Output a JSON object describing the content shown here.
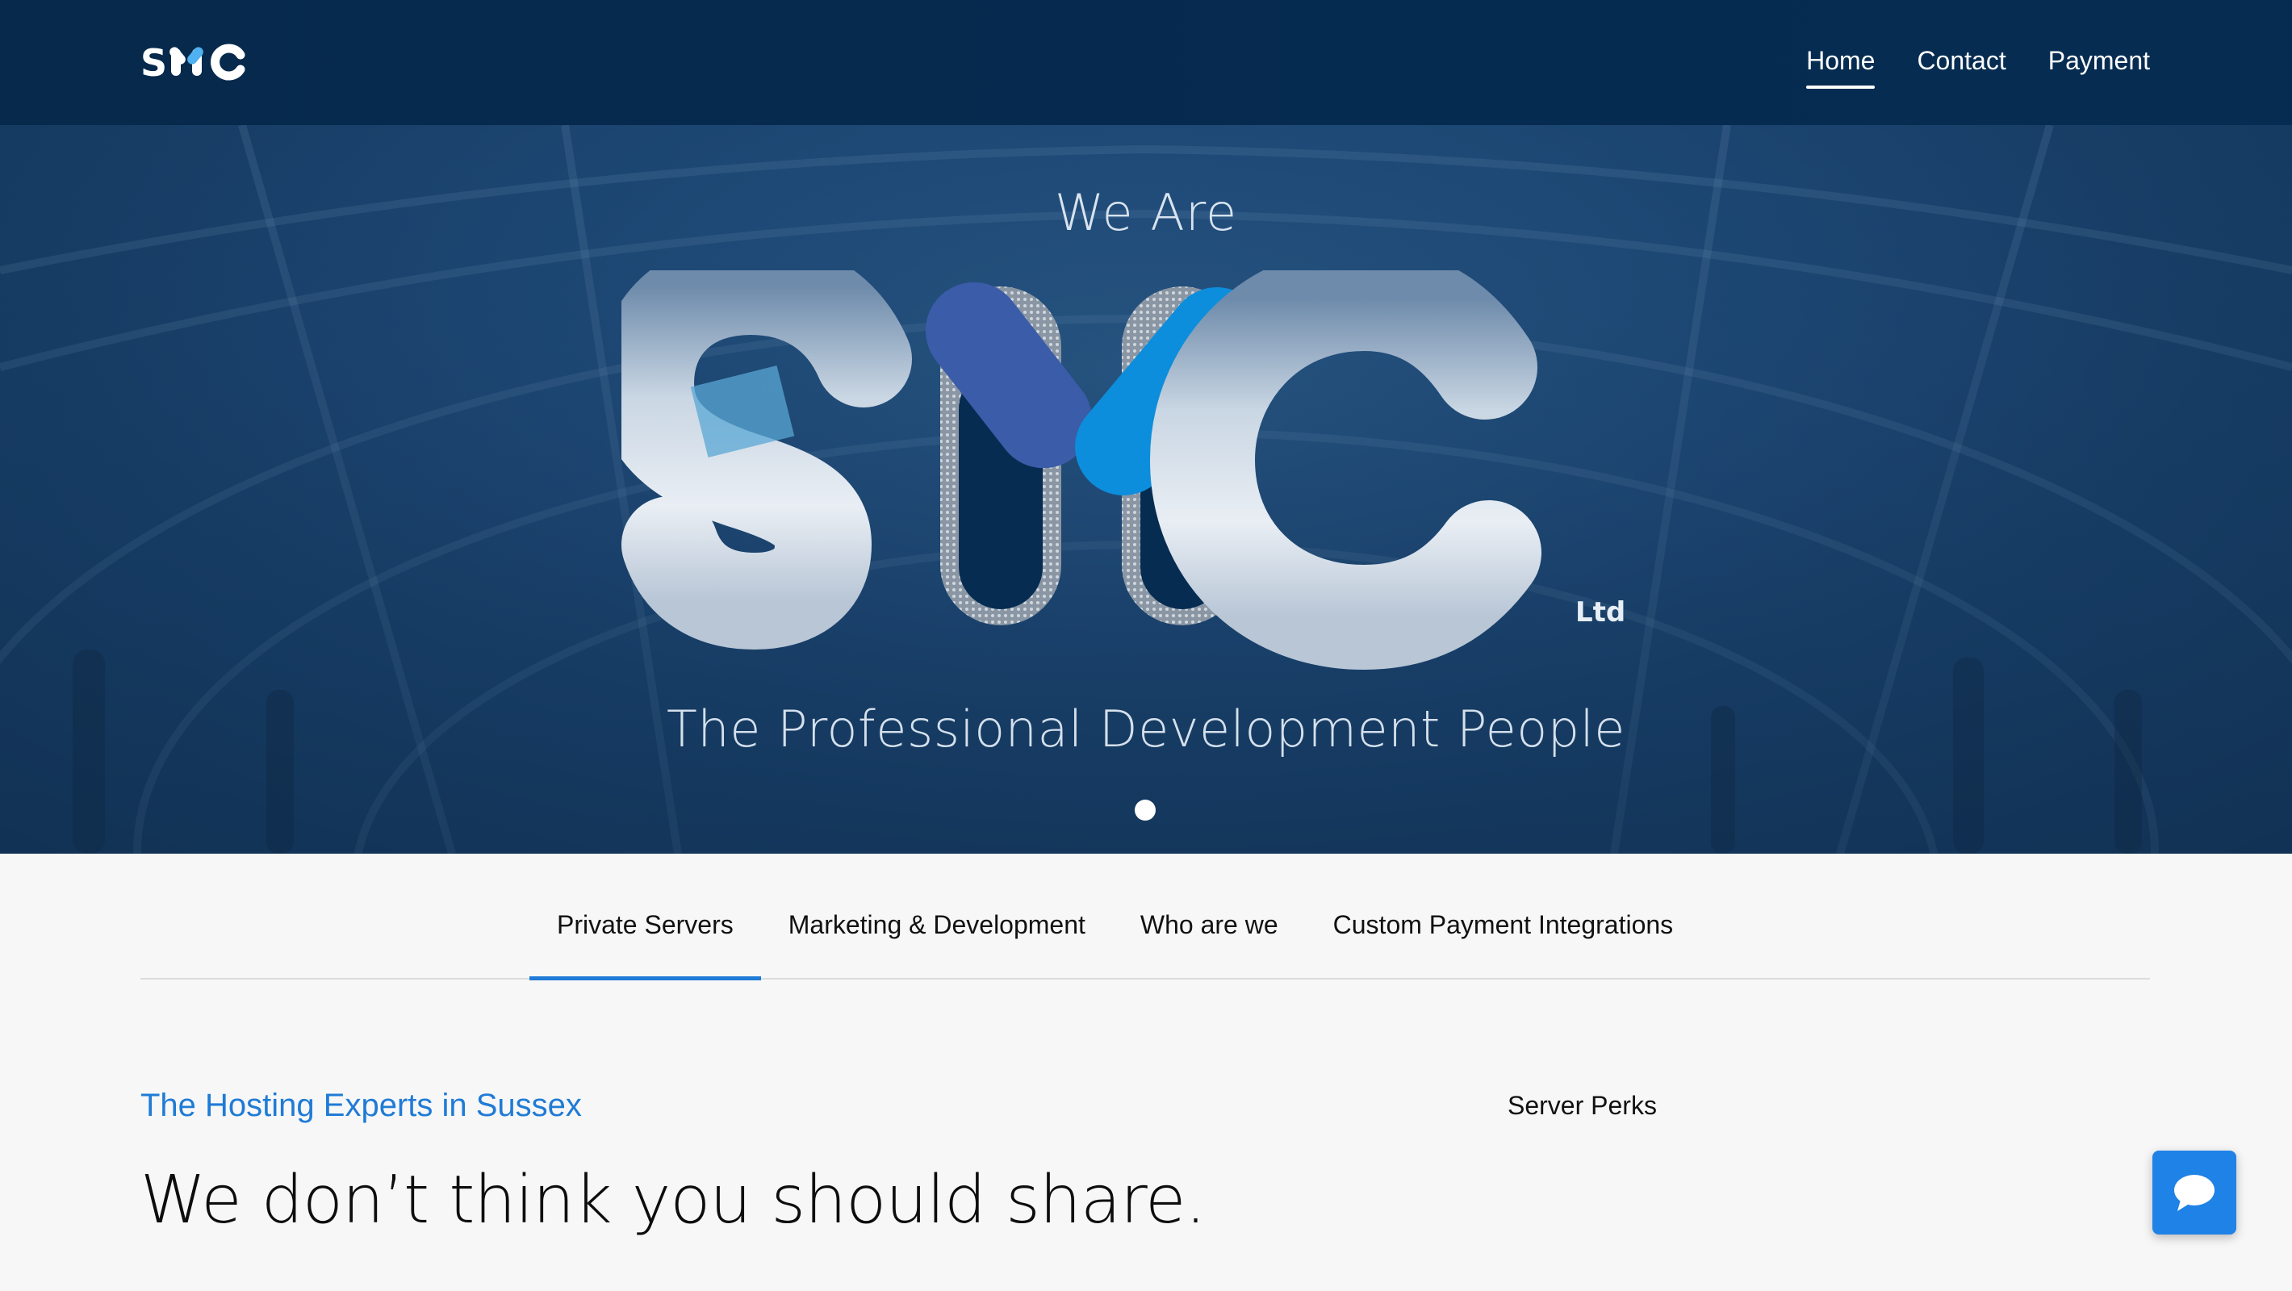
{
  "nav": {
    "logo_text": "SMC",
    "links": [
      {
        "label": "Home",
        "active": true
      },
      {
        "label": "Contact",
        "active": false
      },
      {
        "label": "Payment",
        "active": false
      }
    ]
  },
  "hero": {
    "kicker": "We Are",
    "logo_letters": "SMC",
    "logo_suffix": "Ltd",
    "tagline": "The Professional Development People",
    "slides": 1,
    "active_slide": 1
  },
  "tabs": [
    {
      "label": "Private Servers",
      "active": true
    },
    {
      "label": "Marketing & Development",
      "active": false
    },
    {
      "label": "Who are we",
      "active": false
    },
    {
      "label": "Custom Payment Integrations",
      "active": false
    }
  ],
  "content": {
    "eyebrow": "The Hosting Experts in Sussex",
    "headline": "We don’t think you should share.",
    "side_heading": "Server Perks"
  },
  "colors": {
    "nav_bg": "#062c52",
    "hero_bg": "#1f4a78",
    "accent_blue": "#1f7bd6",
    "logo_dark_blue": "#062c52",
    "logo_light_blue": "#0d8edc",
    "logo_mid_blue": "#3b5ca8"
  },
  "chat": {
    "icon": "chat-bubble-icon"
  }
}
